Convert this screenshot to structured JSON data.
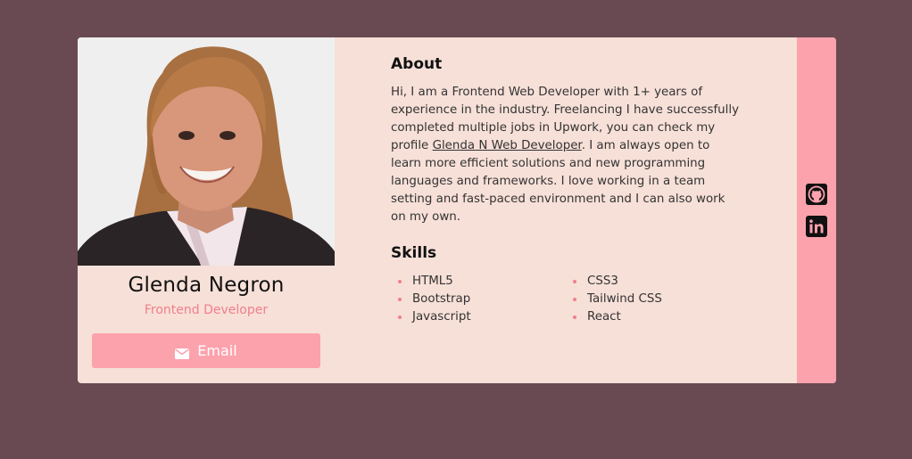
{
  "profile": {
    "name": "Glenda Negron",
    "role": "Frontend Developer",
    "email_label": "Email",
    "photo_icon": "profile-photo"
  },
  "about": {
    "heading": "About",
    "text_before": "Hi, I am a Frontend Web Developer with 1+ years of experience in the industry. Freelancing I have successfully completed multiple jobs in Upwork, you can check my profile ",
    "link_text": "Glenda N Web Developer",
    "text_after": ". I am always open to learn more efficient solutions and new programming languages and frameworks. I love working in a team setting and fast-paced environment and I can also work on my own."
  },
  "skills": {
    "heading": "Skills",
    "items": [
      "HTML5",
      "CSS3",
      "Bootstrap",
      "Tailwind CSS",
      "Javascript",
      "React"
    ]
  },
  "social": {
    "github_icon": "github-icon",
    "linkedin_icon": "linkedin-icon"
  },
  "colors": {
    "page_bg": "#694a52",
    "card_bg": "#f7e0d8",
    "accent": "#fca2ad",
    "accent_text": "#f07f8c"
  }
}
